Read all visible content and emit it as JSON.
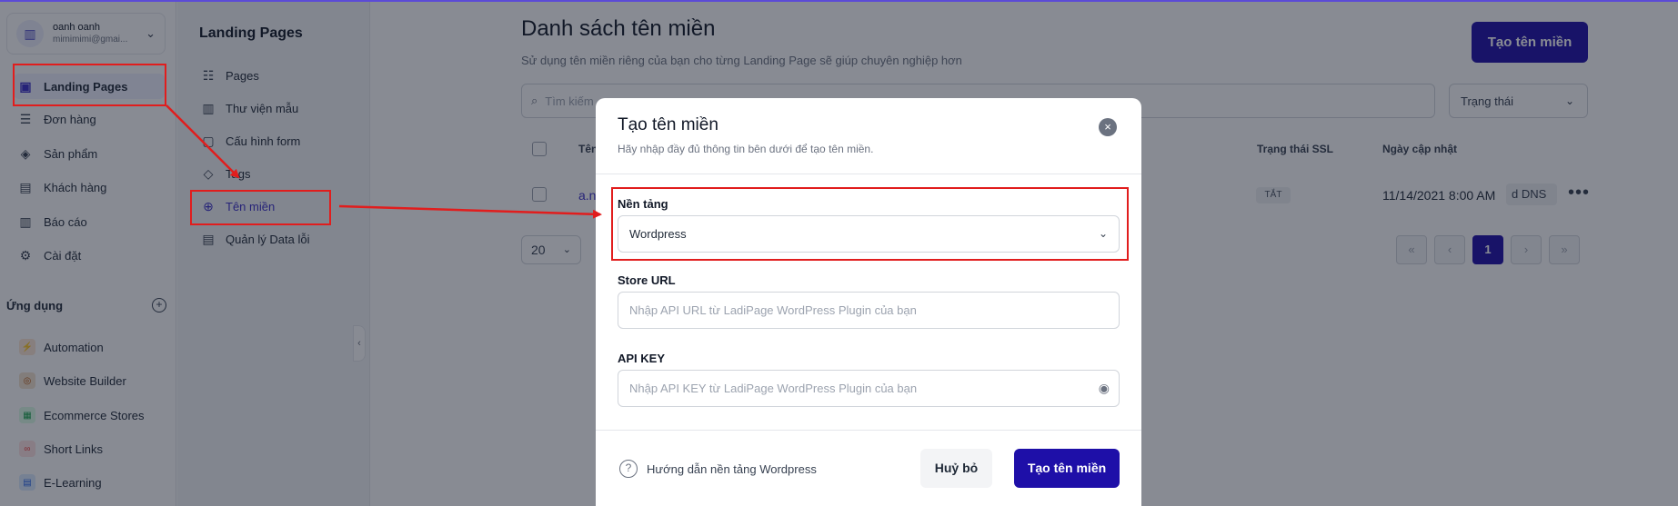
{
  "account": {
    "name": "oanh oanh",
    "email": "mimimimi@gmai..."
  },
  "sidebar": {
    "items": [
      {
        "label": "Landing Pages",
        "icon": "landing-pages-icon"
      },
      {
        "label": "Đơn hàng",
        "icon": "orders-icon"
      },
      {
        "label": "Sản phẩm",
        "icon": "box-icon"
      },
      {
        "label": "Khách hàng",
        "icon": "customers-icon"
      },
      {
        "label": "Báo cáo",
        "icon": "report-icon"
      },
      {
        "label": "Cài đặt",
        "icon": "gear-icon"
      }
    ],
    "apps_title": "Ứng dụng",
    "apps": [
      {
        "label": "Automation",
        "color": "#f97316"
      },
      {
        "label": "Website Builder",
        "color": "#b45309"
      },
      {
        "label": "Ecommerce Stores",
        "color": "#16a34a"
      },
      {
        "label": "Short Links",
        "color": "#ef4444"
      },
      {
        "label": "E-Learning",
        "color": "#2563eb"
      }
    ]
  },
  "subnav": {
    "title": "Landing Pages",
    "items": [
      {
        "label": "Pages"
      },
      {
        "label": "Thư viện mẫu"
      },
      {
        "label": "Cấu hình form"
      },
      {
        "label": "Tags"
      },
      {
        "label": "Tên miền"
      },
      {
        "label": "Quản lý Data lỗi"
      }
    ]
  },
  "main": {
    "title": "Danh sách tên miền",
    "subtitle": "Sử dụng tên miền riêng của bạn cho từng Landing Page sẽ giúp chuyên nghiệp hơn",
    "create_button": "Tạo tên miền",
    "search_placeholder": "Tìm kiếm",
    "status_filter": "Trạng thái",
    "table": {
      "headers": {
        "name": "Tên",
        "ssl": "Trạng thái SSL",
        "updated": "Ngày cập nhật"
      },
      "rows": [
        {
          "name": "a.n",
          "dns": "d DNS",
          "ssl": "TẮT",
          "updated": "11/14/2021 8:00 AM"
        }
      ]
    },
    "page_size": "20",
    "pagination": {
      "current": "1"
    }
  },
  "modal": {
    "title": "Tạo tên miền",
    "subtitle": "Hãy nhập đầy đủ thông tin bên dưới để tạo tên miền.",
    "platform_label": "Nền tảng",
    "platform_value": "Wordpress",
    "store_url_label": "Store URL",
    "store_url_placeholder": "Nhập API URL từ LadiPage WordPress Plugin của bạn",
    "api_key_label": "API KEY",
    "api_key_placeholder": "Nhập API KEY từ LadiPage WordPress Plugin của bạn",
    "help_text": "Hướng dẫn nền tảng Wordpress",
    "cancel_label": "Huỷ bỏ",
    "submit_label": "Tạo tên miền"
  },
  "colors": {
    "primary": "#1e0fa8",
    "annotation": "#e11d1d",
    "overlay": "rgba(17,24,39,0.5)"
  }
}
